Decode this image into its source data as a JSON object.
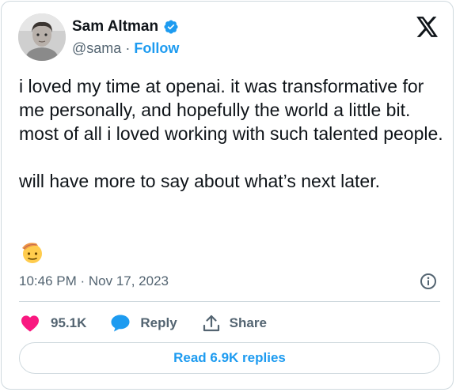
{
  "author": {
    "name": "Sam Altman",
    "handle": "@sama",
    "separator": "·",
    "follow_label": "Follow",
    "verified_icon": "verified-badge-icon",
    "avatar_icon": "profile-photo"
  },
  "brand_icon": "x-logo-icon",
  "tweet": {
    "text": "i loved my time at openai. it was transformative for me personally, and hopefully the world a little bit. most of all i loved working with such talented people.\n\nwill have more to say about what’s next later.",
    "emoji_icon": "saluting-face-emoji",
    "timestamp": "10:46 PM · Nov 17, 2023"
  },
  "actions": {
    "like_count": "95.1K",
    "reply_label": "Reply",
    "share_label": "Share"
  },
  "read_replies_label": "Read 6.9K replies",
  "colors": {
    "accent": "#1d9bf0",
    "like": "#f91880",
    "muted": "#536471",
    "border": "#cfd9de",
    "text": "#0f1419"
  }
}
